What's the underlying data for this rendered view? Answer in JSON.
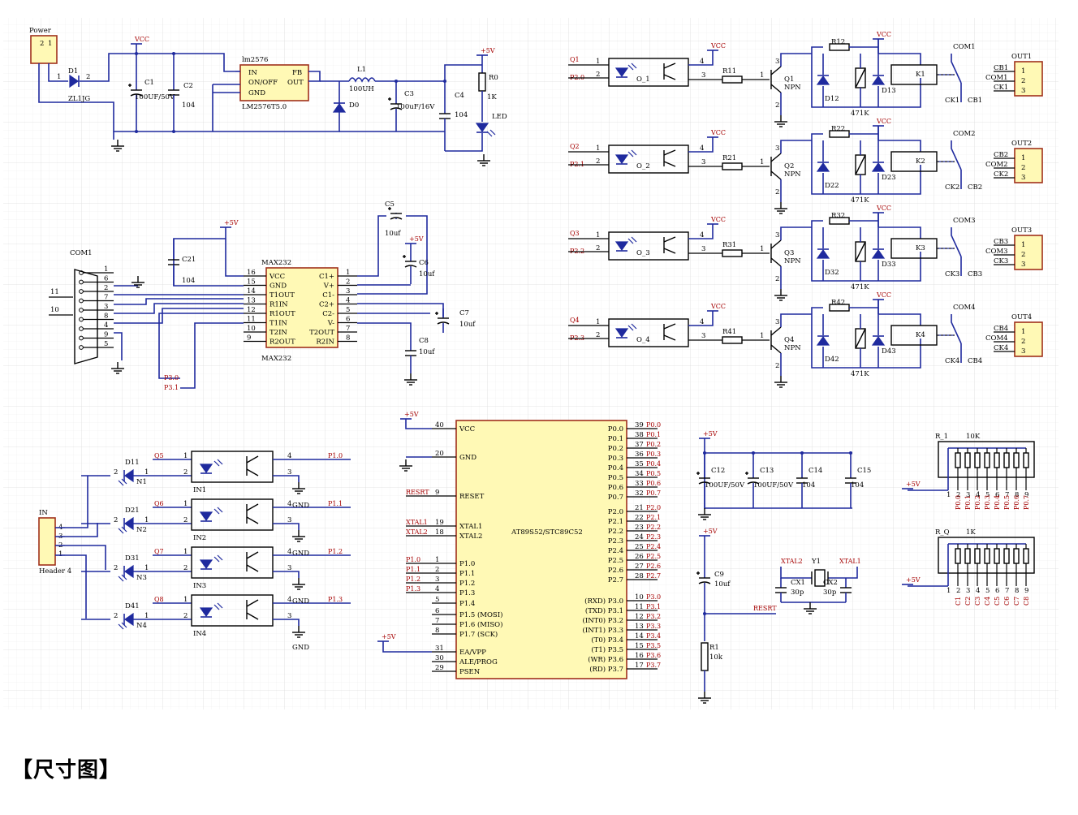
{
  "power_block": {
    "power_header": "Power",
    "d1": "D1",
    "d1_part": "ZL1JG",
    "vcc": "VCC",
    "c1": "C1",
    "c1_val": "100UF/50V",
    "c2": "C2",
    "c2_val": "104",
    "reg_name": "lm2576",
    "reg_in": "IN",
    "reg_onoff": "ON/OFF",
    "reg_gnd": "GND",
    "reg_fb": "FB",
    "reg_out": "OUT",
    "reg_part": "LM2576T5.0",
    "l1": "L1",
    "l1_val": "100UH",
    "d0": "D0",
    "c3": "C3",
    "c3_val": "100uF/16V",
    "c4": "C4",
    "c4_val": "104",
    "p5v": "+5V",
    "r0": "R0",
    "r0_val": "1K",
    "led": "LED"
  },
  "max232_block": {
    "com1": "COM1",
    "c21": "C21",
    "c21_val": "104",
    "p5v": "+5V",
    "chip_label": "MAX232",
    "chip_pins_left": [
      "VCC",
      "GND",
      "T1OUT",
      "R1IN",
      "R1OUT",
      "T1IN",
      "T2IN",
      "R2OUT"
    ],
    "chip_pins_right": [
      "C1+",
      "V+",
      "C1-",
      "C2+",
      "C2-",
      "V-",
      "T2OUT",
      "R2IN"
    ],
    "left_nums": [
      "16",
      "15",
      "14",
      "13",
      "12",
      "11",
      "10",
      "9"
    ],
    "right_nums": [
      "1",
      "2",
      "3",
      "4",
      "5",
      "6",
      "7",
      "8"
    ],
    "c5": "C5",
    "c5_val": "10uf",
    "c6": "C6",
    "c6_val": "10uf",
    "c7": "C7",
    "c7_val": "10uf",
    "c8": "C8",
    "c8_val": "10uf",
    "p30": "P3.0",
    "p31": "P3.1",
    "n11": "11",
    "n10": "10",
    "db9_pins": [
      "1",
      "6",
      "2",
      "7",
      "3",
      "8",
      "4",
      "9",
      "5"
    ]
  },
  "relay_channels": [
    {
      "q_in": "Q1",
      "port": "P2.0",
      "opto": "O_1",
      "r": "R11",
      "q": "Q1",
      "npn": "NPN",
      "rtop": "R12",
      "d2": "D12",
      "d3": "D13",
      "k": "K1",
      "com": "COM1",
      "out": "OUT1",
      "cb": "CB1",
      "ck": "CK1",
      "rv": "471K"
    },
    {
      "q_in": "Q2",
      "port": "P2.1",
      "opto": "O_2",
      "r": "R21",
      "q": "Q2",
      "npn": "NPN",
      "rtop": "R22",
      "d2": "D22",
      "d3": "D23",
      "k": "K2",
      "com": "COM2",
      "out": "OUT2",
      "cb": "CB2",
      "ck": "CK2",
      "rv": "471K"
    },
    {
      "q_in": "Q3",
      "port": "P2.2",
      "opto": "O_3",
      "r": "R31",
      "q": "Q3",
      "npn": "NPN",
      "rtop": "R32",
      "d2": "D32",
      "d3": "D33",
      "k": "K3",
      "com": "COM3",
      "out": "OUT3",
      "cb": "CB3",
      "ck": "CK3",
      "rv": "471K"
    },
    {
      "q_in": "Q4",
      "port": "P2.3",
      "opto": "O_4",
      "r": "R41",
      "q": "Q4",
      "npn": "NPN",
      "rtop": "R42",
      "d2": "D42",
      "d3": "D43",
      "k": "K4",
      "com": "COM4",
      "out": "OUT4",
      "cb": "CB4",
      "ck": "CK4",
      "rv": "471K"
    }
  ],
  "relay_vcc": "VCC",
  "input_block": {
    "in_label": "IN",
    "header": "Header 4",
    "header_pins": [
      "4",
      "3",
      "2",
      "1"
    ],
    "gnd": "GND",
    "channels": [
      {
        "d": "D11",
        "n": "N1",
        "q": "Q5",
        "in": "IN1",
        "port": "P1.0"
      },
      {
        "d": "D21",
        "n": "N2",
        "q": "Q6",
        "in": "IN2",
        "port": "P1.1"
      },
      {
        "d": "D31",
        "n": "N3",
        "q": "Q7",
        "in": "IN3",
        "port": "P1.2"
      },
      {
        "d": "D41",
        "n": "N4",
        "q": "Q8",
        "in": "IN4",
        "port": "P1.3"
      }
    ]
  },
  "mcu": {
    "part": "AT89S52/STC89C52",
    "p5v": "+5V",
    "left_pins": [
      {
        "num": "40",
        "name": "VCC",
        "net": "+5V"
      },
      {
        "num": "20",
        "name": "GND",
        "net": ""
      },
      {
        "num": "9",
        "name": "RESET",
        "net": "RESRT"
      },
      {
        "num": "19",
        "name": "XTAL1",
        "net": "XTAL1"
      },
      {
        "num": "18",
        "name": "XTAL2",
        "net": "XTAL2"
      },
      {
        "num": "1",
        "name": "P1.0",
        "net": "P1.0"
      },
      {
        "num": "2",
        "name": "P1.1",
        "net": "P1.1"
      },
      {
        "num": "3",
        "name": "P1.2",
        "net": "P1.2"
      },
      {
        "num": "4",
        "name": "P1.3",
        "net": "P1.3"
      },
      {
        "num": "5",
        "name": "P1.4",
        "net": ""
      },
      {
        "num": "6",
        "name": "P1.5 (MOSI)",
        "net": ""
      },
      {
        "num": "7",
        "name": "P1.6 (MISO)",
        "net": ""
      },
      {
        "num": "8",
        "name": "P1.7 (SCK)",
        "net": ""
      },
      {
        "num": "31",
        "name": "EA/VPP",
        "net": "+5V"
      },
      {
        "num": "30",
        "name": "ALE/PROG",
        "net": ""
      },
      {
        "num": "29",
        "name": "PSEN",
        "net": ""
      }
    ],
    "right_pins": [
      {
        "num": "39",
        "name": "P0.0",
        "net": "P0.0"
      },
      {
        "num": "38",
        "name": "P0.1",
        "net": "P0.1"
      },
      {
        "num": "37",
        "name": "P0.2",
        "net": "P0.2"
      },
      {
        "num": "36",
        "name": "P0.3",
        "net": "P0.3"
      },
      {
        "num": "35",
        "name": "P0.4",
        "net": "P0.4"
      },
      {
        "num": "34",
        "name": "P0.5",
        "net": "P0.5"
      },
      {
        "num": "33",
        "name": "P0.6",
        "net": "P0.6"
      },
      {
        "num": "32",
        "name": "P0.7",
        "net": "P0.7"
      },
      {
        "num": "21",
        "name": "P2.0",
        "net": "P2.0"
      },
      {
        "num": "22",
        "name": "P2.1",
        "net": "P2.1"
      },
      {
        "num": "23",
        "name": "P2.2",
        "net": "P2.2"
      },
      {
        "num": "24",
        "name": "P2.3",
        "net": "P2.3"
      },
      {
        "num": "25",
        "name": "P2.4",
        "net": "P2.4"
      },
      {
        "num": "26",
        "name": "P2.5",
        "net": "P2.5"
      },
      {
        "num": "27",
        "name": "P2.6",
        "net": "P2.6"
      },
      {
        "num": "28",
        "name": "P2.7",
        "net": "P2.7"
      },
      {
        "num": "10",
        "name": "(RXD) P3.0",
        "net": "P3.0"
      },
      {
        "num": "11",
        "name": "(TXD) P3.1",
        "net": "P3.1"
      },
      {
        "num": "12",
        "name": "(INT0) P3.2",
        "net": "P3.2"
      },
      {
        "num": "13",
        "name": "(INT1) P3.3",
        "net": "P3.3"
      },
      {
        "num": "14",
        "name": "(T0) P3.4",
        "net": "P3.4"
      },
      {
        "num": "15",
        "name": "(T1) P3.5",
        "net": "P3.5"
      },
      {
        "num": "16",
        "name": "(WR) P3.6",
        "net": "P3.6"
      },
      {
        "num": "17",
        "name": "(RD) P3.7",
        "net": "P3.7"
      }
    ]
  },
  "decoupling": {
    "p5v": "+5V",
    "c12": "C12",
    "c12_val": "100UF/50V",
    "c13": "C13",
    "c13_val": "100UF/50V",
    "c14": "C14",
    "c14_val": "104",
    "c15": "C15",
    "c15_val": "104"
  },
  "reset": {
    "p5v": "+5V",
    "c9": "C9",
    "c9_val": "10uf",
    "resrt": "RESRT",
    "r1": "R1",
    "r1_val": "10k"
  },
  "crystal": {
    "xtal2": "XTAL2",
    "xtal1": "XTAL1",
    "y1": "Y1",
    "cx1": "CX1",
    "cx1_val": "30p",
    "cx2": "CX2",
    "cx2_val": "30p"
  },
  "resistor_arrays": [
    {
      "name": "R_1",
      "value": "10K",
      "p5v": "+5V",
      "pins": [
        "1",
        "2",
        "3",
        "4",
        "5",
        "6",
        "7",
        "8",
        "9"
      ],
      "nets": [
        "P0.0",
        "P0.1",
        "P0.2",
        "P0.3",
        "P0.4",
        "P0.5",
        "P0.6",
        "P0.7"
      ]
    },
    {
      "name": "R_Q",
      "value": "1K",
      "p5v": "+5V",
      "pins": [
        "1",
        "2",
        "3",
        "4",
        "5",
        "6",
        "7",
        "8",
        "9"
      ],
      "nets": [
        "C1",
        "C2",
        "C3",
        "C4",
        "C5",
        "C6",
        "C7",
        "C8"
      ]
    }
  ],
  "caption": "【尺寸图】"
}
